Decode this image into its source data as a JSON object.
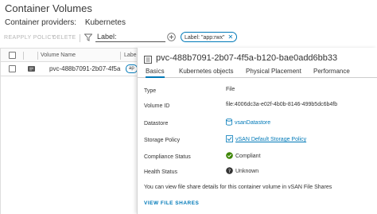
{
  "page": {
    "title": "Container Volumes"
  },
  "providers": {
    "label": "Container providers:",
    "value": "Kubernetes"
  },
  "toolbar": {
    "reapply_policy": "REAPPLY POLICY",
    "delete": "DELETE",
    "filter_label": "Label:",
    "chip_text": "Label: \"app:rwx\"",
    "chip_close": "✕"
  },
  "grid": {
    "columns": [
      "Volume Name",
      "Labe"
    ],
    "rows": [
      {
        "name": "pvc-488b7091-2b07-4f5a",
        "label": "ap"
      }
    ]
  },
  "panel": {
    "title": "pvc-488b7091-2b07-4f5a-b120-bae0add6bb33",
    "tabs": [
      "Basics",
      "Kubernetes objects",
      "Physical Placement",
      "Performance"
    ],
    "active_tab": "Basics",
    "props": {
      "type_label": "Type",
      "type_value": "File",
      "volume_id_label": "Volume ID",
      "volume_id_value": "file:4006dc3a-e02f-4b0b-8146-499b5dc6b4fb",
      "datastore_label": "Datastore",
      "datastore_value": "vsanDatastore",
      "storage_policy_label": "Storage Policy",
      "storage_policy_value": "vSAN Default Storage Policy",
      "compliance_label": "Compliance Status",
      "compliance_value": "Compliant",
      "health_label": "Health Status",
      "health_value": "Unknown"
    },
    "note": "You can view file share details for this container volume in vSAN File Shares",
    "view_file_shares": "VIEW FILE SHARES"
  },
  "colors": {
    "accent": "#0079b8",
    "compliant": "#3c8500",
    "unknown": "#333333"
  }
}
